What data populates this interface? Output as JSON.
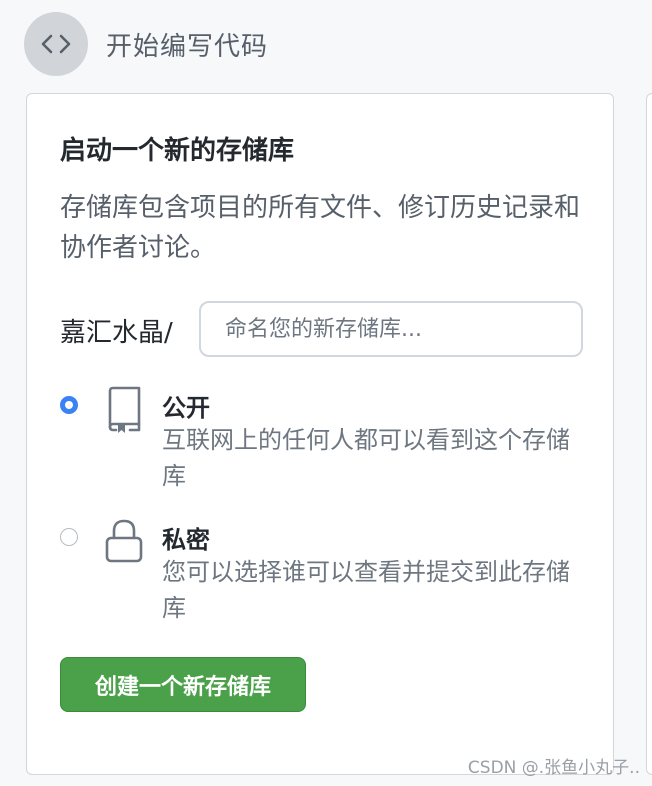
{
  "header": {
    "title": "开始编写代码",
    "icon": "code-brackets-icon"
  },
  "card": {
    "title": "启动一个新的存储库",
    "description": "存储库包含项目的所有文件、修订历史记录和协作者讨论。",
    "owner": "嘉汇水晶/",
    "repo_name_placeholder": "命名您的新存储库...",
    "options": [
      {
        "title": "公开",
        "description": "互联网上的任何人都可以看到这个存储库",
        "icon": "repo-book-icon",
        "selected": true
      },
      {
        "title": "私密",
        "description": "您可以选择谁可以查看并提交到此存储库",
        "icon": "lock-icon",
        "selected": false
      }
    ],
    "create_button": "创建一个新存储库"
  },
  "watermark": "CSDN @.张鱼小丸子..",
  "colors": {
    "accent_blue": "#3b82f6",
    "button_green": "#4aa14a",
    "muted_text": "#57606a"
  }
}
